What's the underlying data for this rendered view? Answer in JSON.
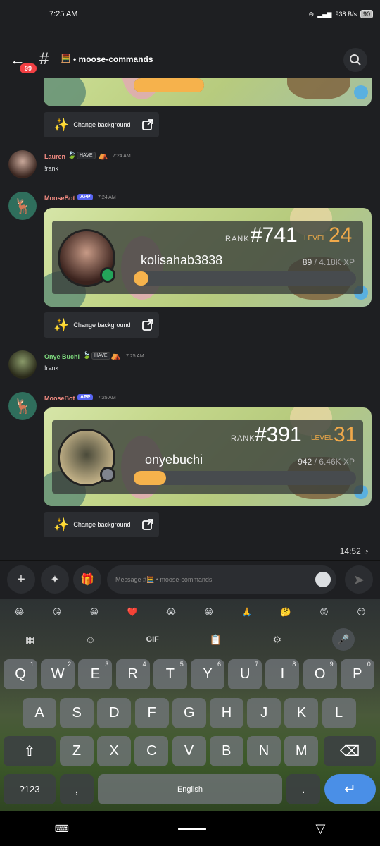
{
  "status_bar": {
    "time": "7:25 AM",
    "net_speed": "938 B/s",
    "battery": "90"
  },
  "header": {
    "badge": "99",
    "channel_emoji": "🧮",
    "channel_name": "• moose-commands"
  },
  "messages": [
    {
      "type": "card_partial",
      "xp_fill": 0.3
    },
    {
      "type": "button",
      "label": "Change background"
    },
    {
      "type": "user",
      "name": "Lauren",
      "name_color": "#f28b82",
      "tag": "HAVE",
      "time": "7:24 AM",
      "text": "!rank"
    },
    {
      "type": "bot",
      "name": "MooseBot",
      "app": "APP",
      "time": "7:24 AM",
      "card": {
        "rank_label": "RANK",
        "rank": "#741",
        "level_label": "LEVEL",
        "level": "24",
        "username": "kolisahab3838",
        "xp": "89",
        "xp_total": "/ 4.18K XP",
        "xp_fill": 0.021
      }
    },
    {
      "type": "button",
      "label": "Change background"
    },
    {
      "type": "user",
      "name": "Onye Buchi",
      "name_color": "#7dd87d",
      "tag": "HAVE",
      "time": "7:25 AM",
      "text": "!rank"
    },
    {
      "type": "bot",
      "name": "MooseBot",
      "app": "APP",
      "time": "7:25 AM",
      "card": {
        "rank_label": "RANK",
        "rank": "#391",
        "level_label": "LEVEL",
        "level": "31",
        "username": "onyebuchi",
        "xp": "942",
        "xp_total": "/ 6.46K XP",
        "xp_fill": 0.146
      }
    },
    {
      "type": "button",
      "label": "Change background"
    }
  ],
  "clock_stamp": "14:52",
  "composer": {
    "placeholder": "Message #🧮 • moose-commands"
  },
  "keyboard": {
    "emojis": [
      "😂",
      "😘",
      "😀",
      "❤️",
      "😭",
      "😁",
      "🙏",
      "🤔",
      "😡",
      "😔"
    ],
    "gif_label": "GIF",
    "row1": [
      "Q",
      "W",
      "E",
      "R",
      "T",
      "Y",
      "U",
      "I",
      "O",
      "P"
    ],
    "row1_sup": [
      "1",
      "2",
      "3",
      "4",
      "5",
      "6",
      "7",
      "8",
      "9",
      "0"
    ],
    "row2": [
      "A",
      "S",
      "D",
      "F",
      "G",
      "H",
      "J",
      "K",
      "L"
    ],
    "row3": [
      "Z",
      "X",
      "C",
      "V",
      "B",
      "N",
      "M"
    ],
    "symbols_label": "?123",
    "comma": ",",
    "space_label": "English",
    "period": "."
  },
  "colors": {
    "accent": "#5865f2",
    "level": "#f0a94a",
    "xp_bar": "#f6b24c",
    "online": "#23a55a",
    "idle": "#80848e",
    "enter": "#4a8fe7"
  }
}
